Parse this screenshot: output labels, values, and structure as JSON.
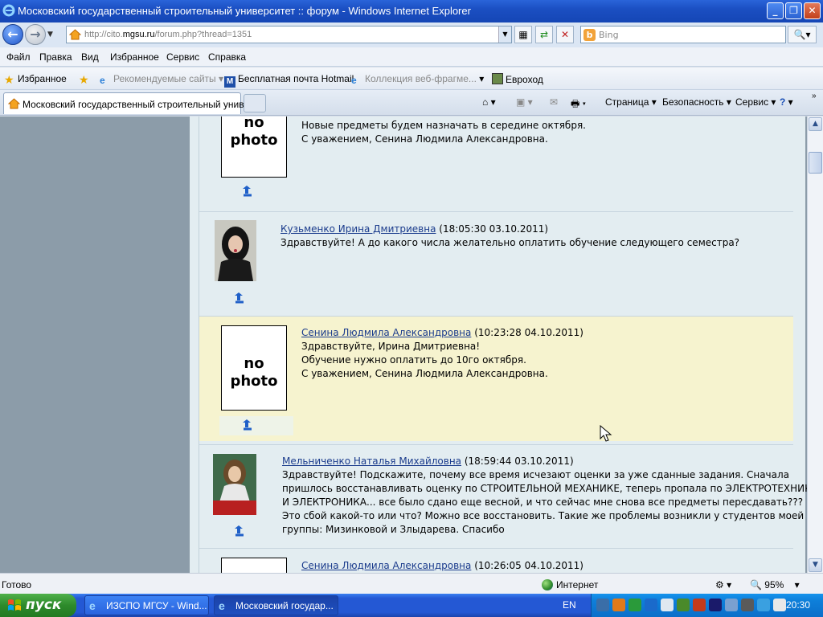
{
  "window": {
    "title": "Московский государственный строительный университет :: форум - Windows Internet Explorer"
  },
  "address": {
    "url_prefix": "http://cito.",
    "url_domain": "mgsu.ru",
    "url_suffix": "/forum.php?thread=1351",
    "search_placeholder": "Bing"
  },
  "menu": [
    "Файл",
    "Правка",
    "Вид",
    "Избранное",
    "Сервис",
    "Справка"
  ],
  "favorites": {
    "label": "Избранное",
    "items": [
      {
        "label": "Рекомендуемые сайты",
        "dropdown": "▾"
      },
      {
        "label": "Бесплатная почта Hotmail"
      },
      {
        "label": "Коллекция веб-фрагме...",
        "dropdown": "▾"
      },
      {
        "label": "Евроход"
      }
    ]
  },
  "tabs": [
    {
      "label": "Московский государственный строительный унив..."
    }
  ],
  "commands": {
    "page": "Страница ▾",
    "safety": "Безопасность ▾",
    "tools": "Сервис ▾",
    "help_arrow": "▾"
  },
  "posts": [
    {
      "author": "",
      "time": "",
      "lines": [
        "Новые предметы будем назначать в середине октября.",
        "С уважением, Сенина Людмила Александровна."
      ],
      "photo": "no photo"
    },
    {
      "author": "Кузьменко Ирина Дмитриевна",
      "time": "(18:05:30 03.10.2011)",
      "lines": [
        "Здравствуйте! А до какого числа желательно оплатить обучение следующего семестра?"
      ]
    },
    {
      "author": "Сенина Людмила Александровна",
      "time": "(10:23:28 04.10.2011)",
      "lines": [
        "Здравствуйте, Ирина Дмитриевна!",
        "Обучение нужно оплатить до 10го октября.",
        "С уважением, Сенина Людмила Александровна."
      ],
      "photo_line1": "no",
      "photo_line2": "photo"
    },
    {
      "author": "Мельниченко Наталья Михайловна",
      "time": "(18:59:44 03.10.2011)",
      "lines": [
        "Здравствуйте! Подскажите, почему все время исчезают оценки за уже сданные задания. Сначала",
        "пришлось восстанавливать оценку по СТРОИТЕЛЬНОЙ МЕХАНИКЕ, теперь пропала по ЭЛЕКТРОТЕХНИКА",
        "И ЭЛЕКТРОНИКА... все было сдано еще весной, и что сейчас мне снова все предметы пересдавать???",
        "Это сбой какой-то или что? Можно все восстановить. Такие же проблемы возникли у студентов моей",
        "группы: Мизинковой и Злыдарева. Спасибо"
      ]
    },
    {
      "author": "Сенина Людмила Александровна",
      "time": "(10:26:05 04.10.2011)"
    }
  ],
  "nophoto": {
    "line1": "no",
    "line2": "photo"
  },
  "status": {
    "text": "Готово",
    "zone": "Интернет",
    "zoom": "95%"
  },
  "taskbar": {
    "start": "пуск",
    "tasks": [
      {
        "label": "ИЗСПО МГСУ - Wind..."
      },
      {
        "label": "Московский государ..."
      }
    ],
    "lang": "EN",
    "clock": "20:30"
  },
  "colors": {
    "link": "#1a3b8c",
    "highlight": "#f6f3cf",
    "page_bg": "#e3edf1"
  }
}
